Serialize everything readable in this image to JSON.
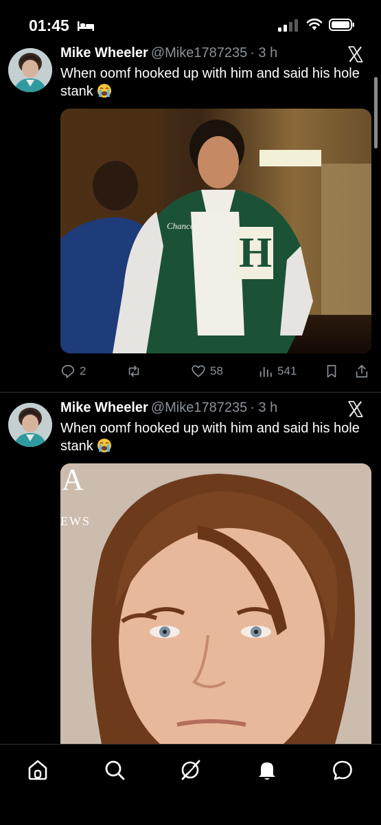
{
  "status_bar": {
    "time": "01:45"
  },
  "tweets": [
    {
      "name": "Mike Wheeler",
      "handle": "@Mike1787235",
      "time": "· 3 h",
      "text": "When oomf hooked up with him and said his hole stank",
      "emoji": "loudly-crying-face",
      "photo_text": {
        "jacket_name": "Chance"
      },
      "actions": {
        "replies": "2",
        "reposts": "",
        "likes": "58",
        "views": "541"
      }
    },
    {
      "name": "Mike Wheeler",
      "handle": "@Mike1787235",
      "time": "· 3 h",
      "text": "When oomf hooked up with him and said his hole stank",
      "emoji": "loudly-crying-face",
      "photo_text": {
        "logo_letter": "A",
        "logo_word": "EWS"
      }
    }
  ],
  "nav": [
    "home-icon",
    "search-icon",
    "grok-icon",
    "notifications-icon",
    "messages-icon"
  ],
  "colors": {
    "background": "#000000",
    "secondary_text": "#8b9299",
    "divider": "#2f3336"
  }
}
